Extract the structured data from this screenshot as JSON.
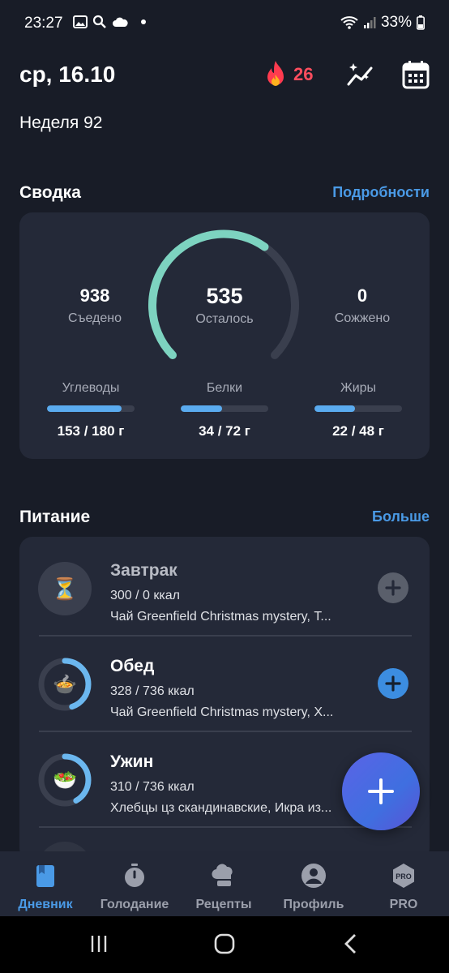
{
  "status_bar": {
    "time": "23:27",
    "battery": "33%"
  },
  "header": {
    "date": "ср, 16.10",
    "streak_count": "26",
    "week": "Неделя 92"
  },
  "summary": {
    "title": "Сводка",
    "details_link": "Подробности",
    "eaten": {
      "value": "938",
      "label": "Съедено"
    },
    "remaining": {
      "value": "535",
      "label": "Осталось"
    },
    "burned": {
      "value": "0",
      "label": "Сожжено"
    },
    "remaining_progress": 0.63,
    "macros": [
      {
        "label": "Углеводы",
        "value": "153 / 180 г",
        "progress": 0.85
      },
      {
        "label": "Белки",
        "value": "34 / 72 г",
        "progress": 0.47
      },
      {
        "label": "Жиры",
        "value": "22 / 48 г",
        "progress": 0.46
      }
    ]
  },
  "nutrition": {
    "title": "Питание",
    "more_link": "Больше",
    "meals": [
      {
        "name": "Завтрак",
        "kcal": "300 / 0 ккал",
        "items": "Чай Greenfield Christmas mystery, Т...",
        "icon": "⏳",
        "progress": 0
      },
      {
        "name": "Обед",
        "kcal": "328 / 736 ккал",
        "items": "Чай Greenfield Christmas mystery, Х...",
        "icon": "🍲",
        "progress": 0.45
      },
      {
        "name": "Ужин",
        "kcal": "310 / 736 ккал",
        "items": "Хлебцы цз скандинавские, Икра из...",
        "icon": "🥗",
        "progress": 0.42
      }
    ]
  },
  "nav": [
    {
      "label": "Дневник",
      "icon": "diary-icon",
      "active": true
    },
    {
      "label": "Голодание",
      "icon": "stopwatch-icon",
      "active": false
    },
    {
      "label": "Рецепты",
      "icon": "chef-hat-icon",
      "active": false
    },
    {
      "label": "Профиль",
      "icon": "profile-icon",
      "active": false
    },
    {
      "label": "PRO",
      "icon": "pro-badge-icon",
      "active": false
    }
  ],
  "colors": {
    "accent": "#4a9ae6",
    "ring": "#7dd3c0",
    "streak": "#ff4d5e",
    "background": "#181c27",
    "card": "#242938"
  }
}
